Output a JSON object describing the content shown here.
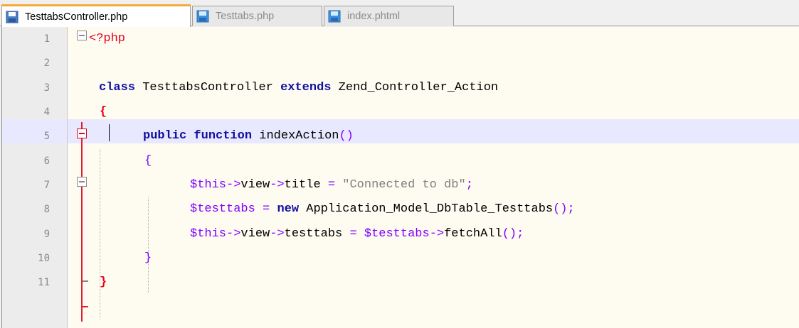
{
  "tabs": [
    {
      "label": "TesttabsController.php",
      "active": true,
      "icon": "save-file-icon"
    },
    {
      "label": "Testtabs.php",
      "active": false,
      "icon": "save-file-icon"
    },
    {
      "label": "index.phtml",
      "active": false,
      "icon": "save-file-icon"
    }
  ],
  "editor": {
    "line_numbers": [
      "1",
      "2",
      "3",
      "4",
      "5",
      "6",
      "7",
      "8",
      "9",
      "10",
      "11"
    ],
    "lines": {
      "l1": {
        "open": "<?php"
      },
      "l3": {
        "class_kw": "class",
        "class_name": " TesttabsController ",
        "extends_kw": "extends",
        "parent": " Zend_Controller_Action"
      },
      "l4": {
        "brace": "{"
      },
      "l5": {
        "public_kw": "public",
        "function_kw": " function",
        "name": " indexAction",
        "parens": "()"
      },
      "l6": {
        "brace": "{"
      },
      "l7": {
        "var": "$this",
        "arrow1": "->",
        "prop1": "view",
        "arrow2": "->",
        "prop2": "title",
        "eq": " = ",
        "str": "\"Connected to db\"",
        "semi": ";"
      },
      "l8": {
        "var": "$testtabs",
        "eq": " = ",
        "new_kw": "new",
        "cls": " Application_Model_DbTable_Testtabs",
        "parens": "()",
        "semi": ";"
      },
      "l9": {
        "var": "$this",
        "arrow1": "->",
        "prop1": "view",
        "arrow2": "->",
        "prop2": "testtabs",
        "eq": " = ",
        "var2": "$testtabs",
        "arrow3": "->",
        "call": "fetchAll",
        "parens": "()",
        "semi": ";"
      },
      "l10": {
        "brace": "}"
      },
      "l11": {
        "brace": "}"
      }
    }
  },
  "colors": {
    "keyword": "#1010a0",
    "variable": "#8000ff",
    "string": "#7f7f7f",
    "php_tag": "#e8001c",
    "active_tab_accent": "#f6a93b",
    "current_line": "#e8e8ff",
    "editor_bg": "#fefbf1"
  }
}
